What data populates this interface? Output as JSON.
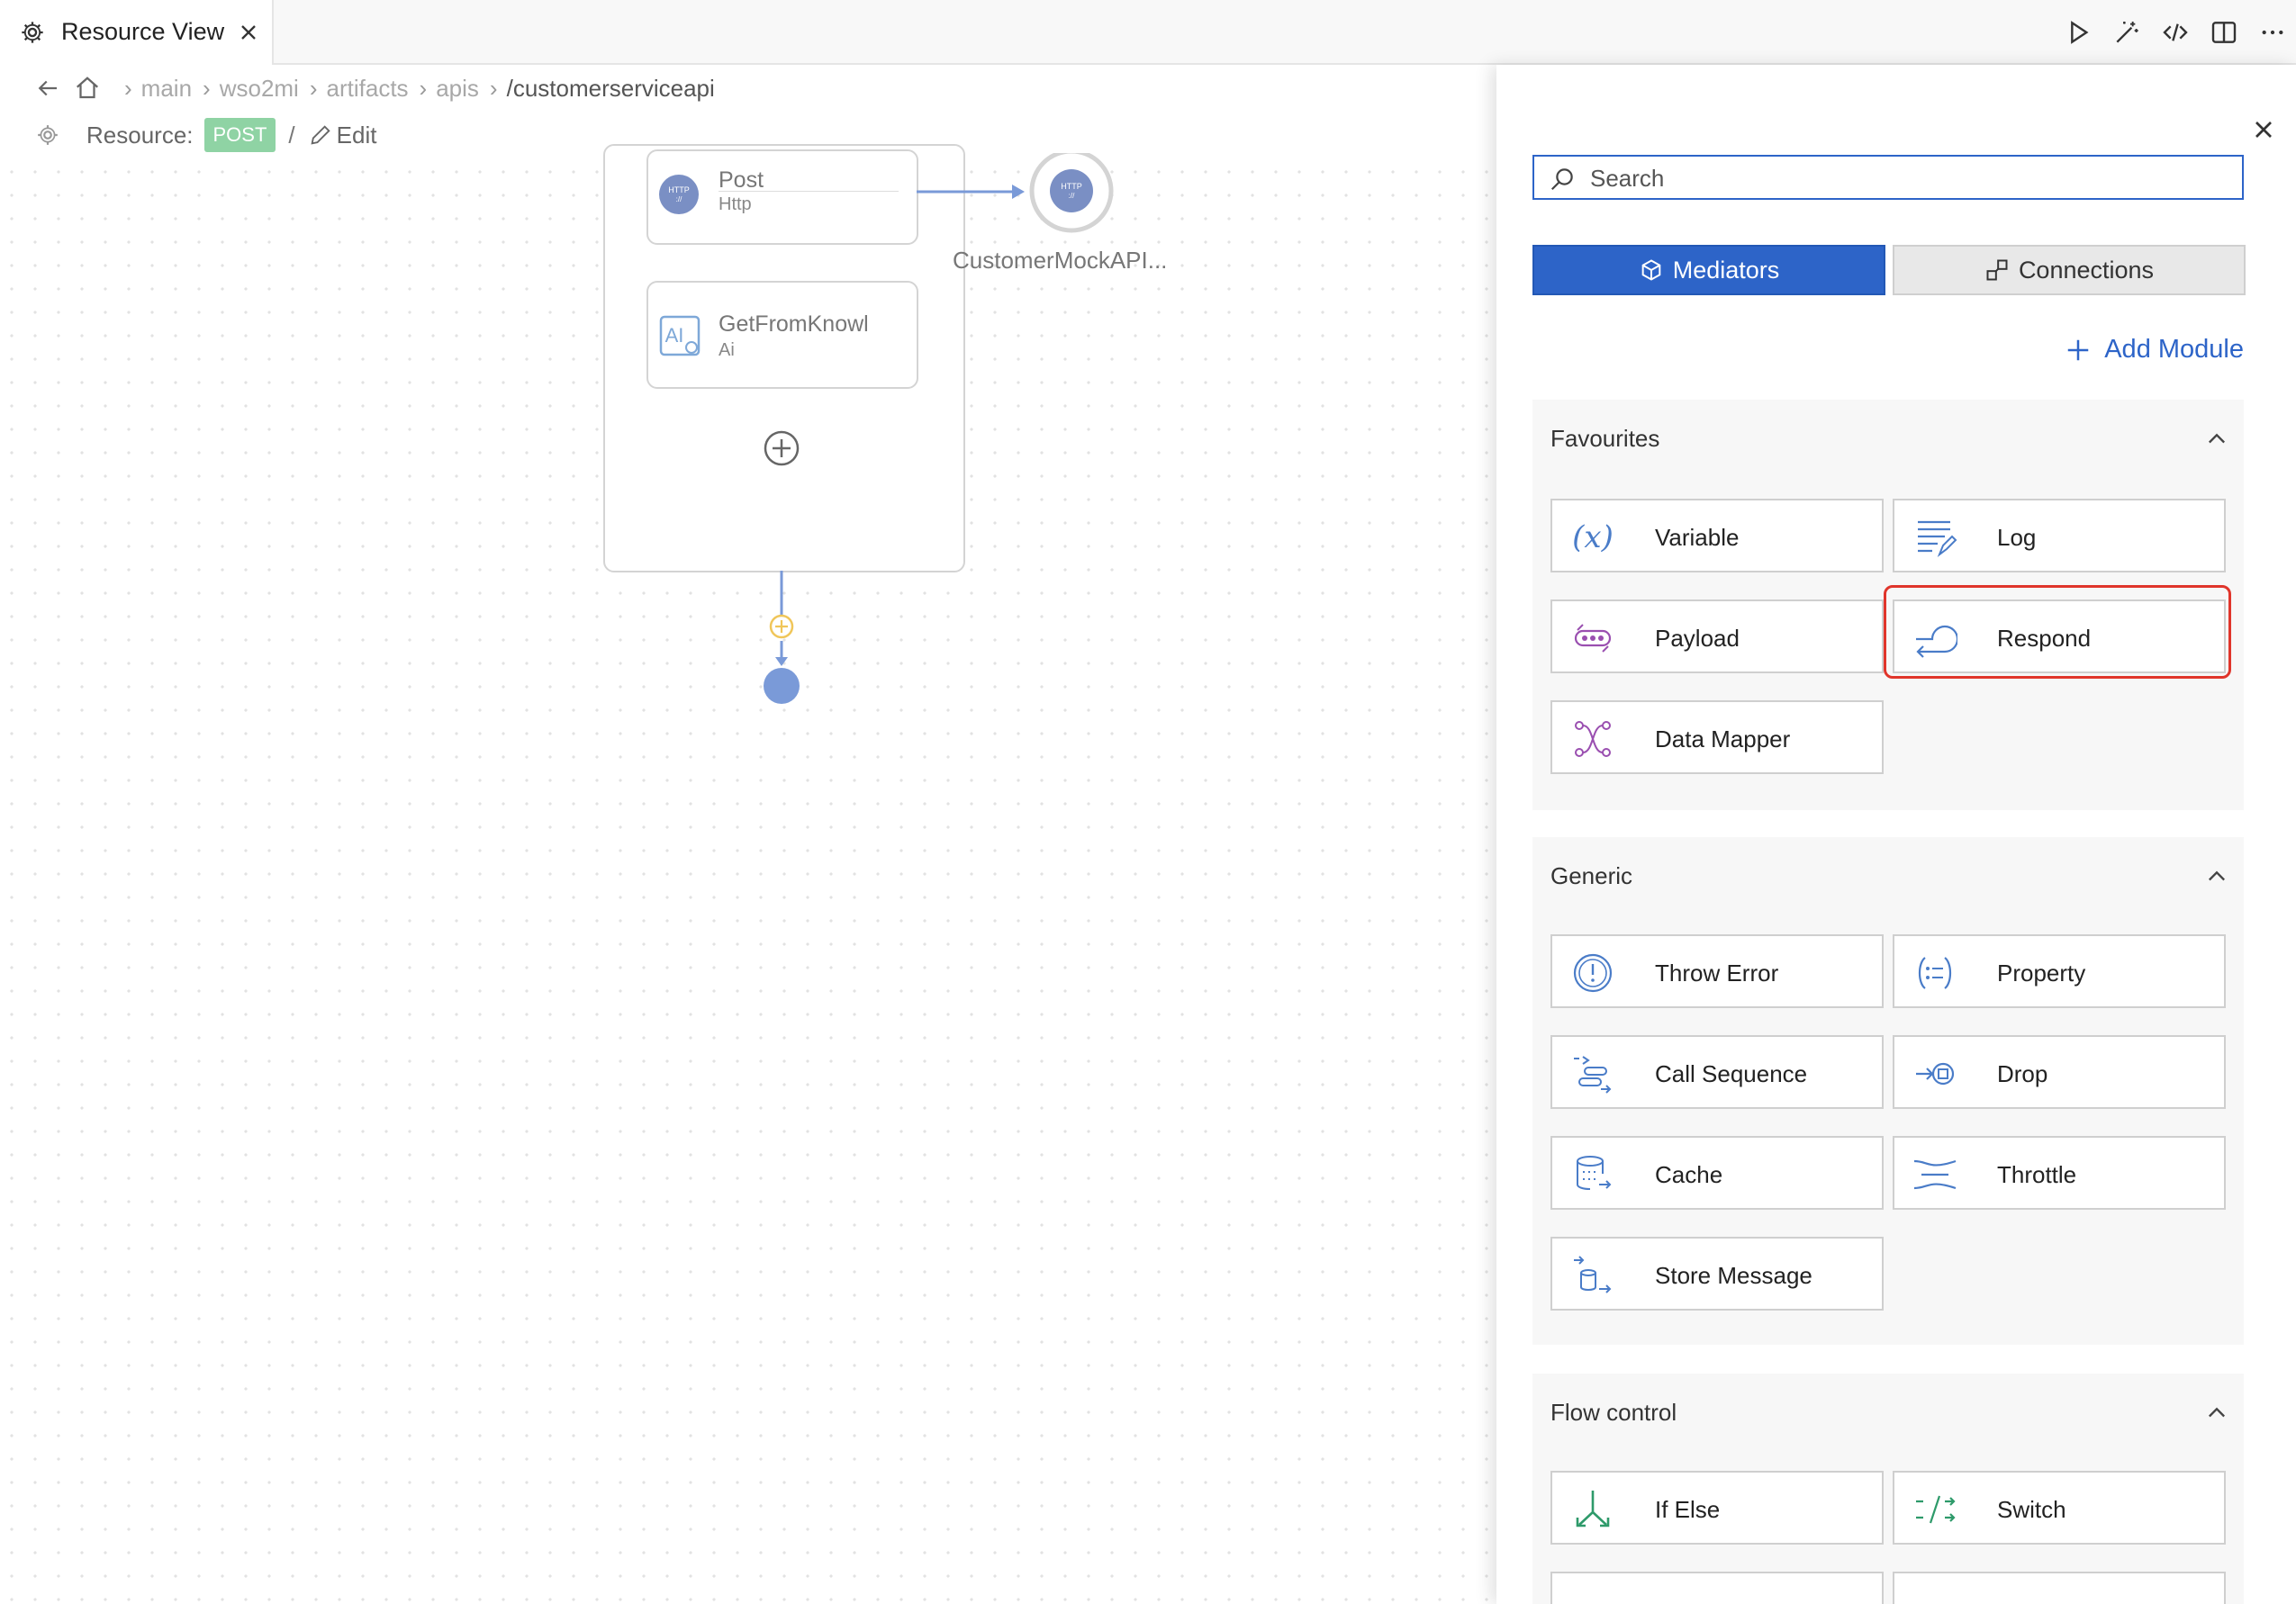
{
  "tab": {
    "title": "Resource View"
  },
  "breadcrumb": {
    "items": [
      "main",
      "wso2mi",
      "artifacts",
      "apis"
    ],
    "current": "/customerserviceapi"
  },
  "resource": {
    "label": "Resource:",
    "method": "POST",
    "separator": "/",
    "edit_label": "Edit"
  },
  "diagram": {
    "nodes": [
      {
        "title": "Post",
        "subtitle": "Http",
        "icon": "http-icon"
      },
      {
        "title": "GetFromKnowl",
        "subtitle": "Ai",
        "icon": "ai-icon"
      }
    ],
    "endpoint": {
      "label": "CustomerMockAPI..."
    }
  },
  "panel": {
    "search_placeholder": "Search",
    "tabs": [
      {
        "label": "Mediators",
        "active": true,
        "icon": "cube-icon"
      },
      {
        "label": "Connections",
        "active": false,
        "icon": "connection-icon"
      }
    ],
    "add_module": "Add Module",
    "sections": [
      {
        "title": "Favourites",
        "items": [
          "Variable",
          "Log",
          "Payload",
          "Respond",
          "Data Mapper"
        ]
      },
      {
        "title": "Generic",
        "items": [
          "Throw Error",
          "Property",
          "Call Sequence",
          "Drop",
          "Cache",
          "Throttle",
          "Store Message"
        ]
      },
      {
        "title": "Flow control",
        "items": [
          "If Else",
          "Switch"
        ]
      }
    ],
    "highlighted": "Respond"
  },
  "colors": {
    "accent": "#2d64c8",
    "post_badge": "#8fd3a4",
    "highlight": "#e0352b",
    "node_icon": "#7a8fc4"
  }
}
